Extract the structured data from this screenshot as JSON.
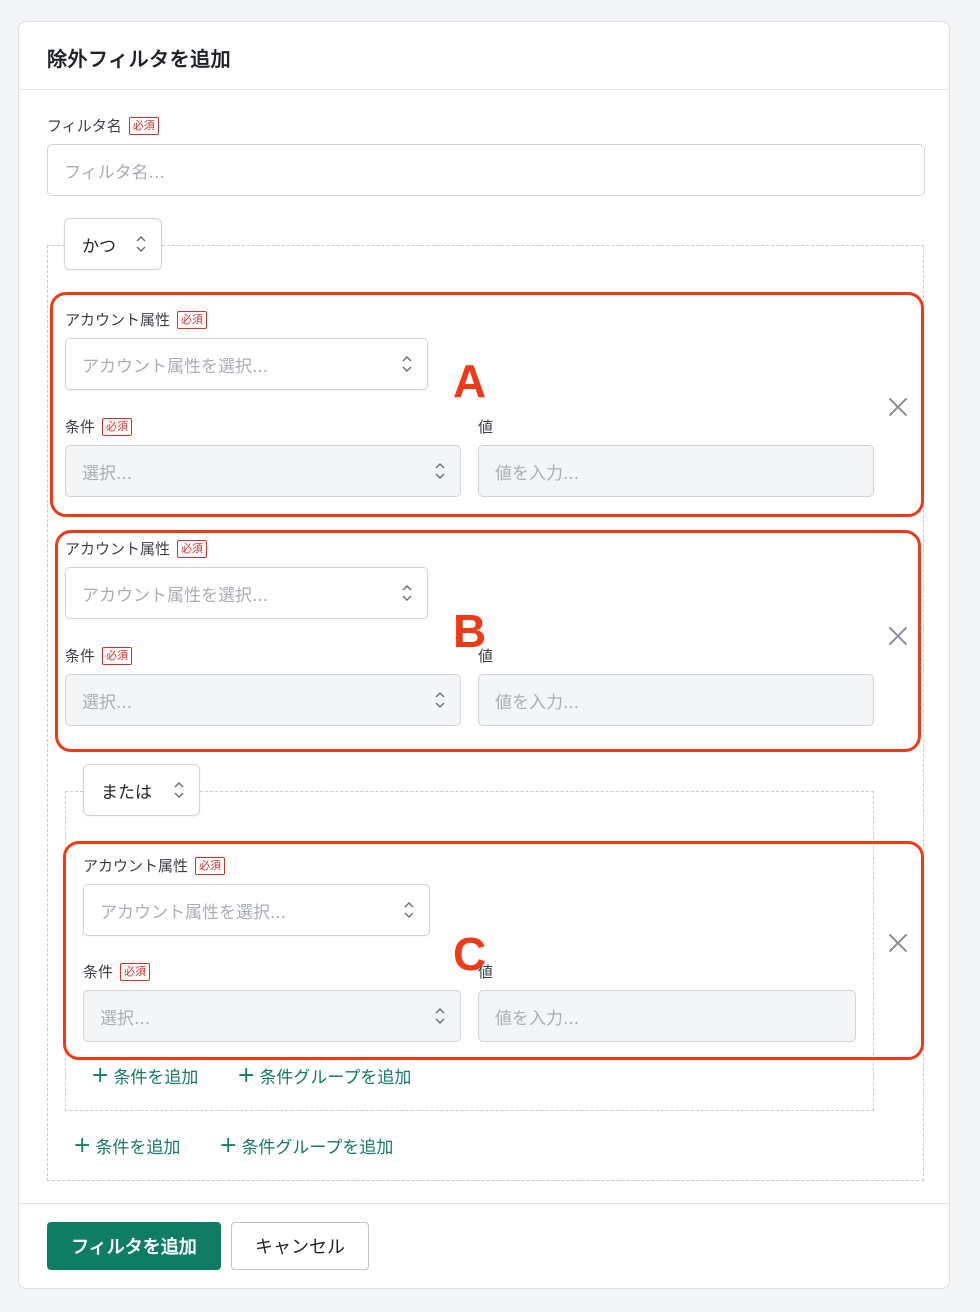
{
  "dialog": {
    "title": "除外フィルタを追加",
    "filter_name_label": "フィルタ名",
    "required_badge": "必須",
    "filter_name_placeholder": "フィルタ名..."
  },
  "outer_group": {
    "operator": "かつ",
    "add_condition": "条件を追加",
    "add_condition_group": "条件グループを追加"
  },
  "inner_group": {
    "operator": "または",
    "add_condition": "条件を追加",
    "add_condition_group": "条件グループを追加"
  },
  "condition_fields": {
    "attribute_label": "アカウント属性",
    "attribute_placeholder": "アカウント属性を選択...",
    "condition_label": "条件",
    "condition_placeholder": "選択...",
    "value_label": "値",
    "value_placeholder": "値を入力..."
  },
  "annotations": [
    "A",
    "B",
    "C"
  ],
  "footer": {
    "submit": "フィルタを追加",
    "cancel": "キャンセル"
  },
  "colors": {
    "primary": "#0f7d63",
    "link": "#137a69",
    "required": "#d9302c",
    "annotation": "#f03a17"
  }
}
